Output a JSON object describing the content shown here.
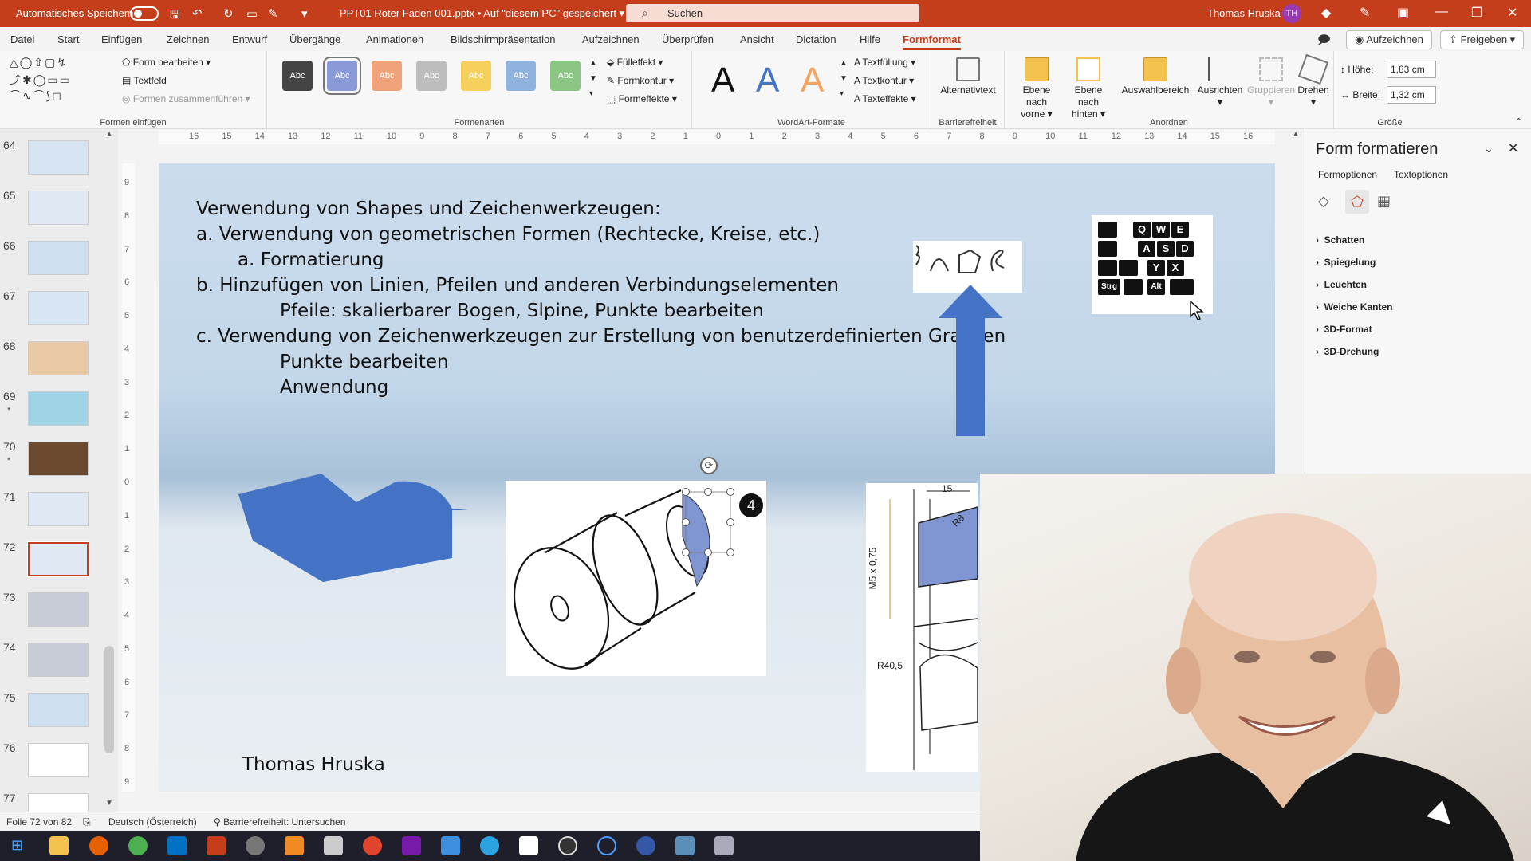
{
  "titlebar": {
    "autosave_label": "Automatisches Speichern",
    "filename": "PPT01 Roter Faden 001.pptx",
    "save_location": "Auf \"diesem PC\" gespeichert",
    "search_placeholder": "Suchen",
    "user_name": "Thomas Hruska",
    "user_initials": "TH"
  },
  "menu": {
    "tabs": [
      "Datei",
      "Start",
      "Einfügen",
      "Zeichnen",
      "Entwurf",
      "Übergänge",
      "Animationen",
      "Bildschirmpräsentation",
      "Aufzeichnen",
      "Überprüfen",
      "Ansicht",
      "Dictation",
      "Hilfe",
      "Formformat"
    ],
    "active_tab": "Formformat",
    "record_button": "Aufzeichnen",
    "share_button": "Freigeben"
  },
  "ribbon": {
    "insert_shapes": {
      "edit_shape": "Form bearbeiten",
      "textbox": "Textfeld",
      "merge_shapes": "Formen zusammenführen",
      "label": "Formen einfügen"
    },
    "shape_styles": {
      "style_text": "Abc",
      "fill": "Fülleffekt",
      "outline": "Formkontur",
      "effects": "Formeffekte",
      "label": "Formenarten"
    },
    "wordart": {
      "letter": "A",
      "text_fill": "Textfüllung",
      "text_outline": "Textkontur",
      "text_effects": "Texteffekte",
      "label": "WordArt-Formate"
    },
    "accessibility": {
      "alt_text": "Alternativtext",
      "label": "Barrierefreiheit"
    },
    "arrange": {
      "bring_forward_1": "Ebene nach",
      "bring_forward_2": "vorne",
      "send_backward_1": "Ebene nach",
      "send_backward_2": "hinten",
      "selection_pane": "Auswahlbereich",
      "align": "Ausrichten",
      "group": "Gruppieren",
      "rotate": "Drehen",
      "label": "Anordnen"
    },
    "size": {
      "height_label": "Höhe:",
      "height_value": "1,83 cm",
      "width_label": "Breite:",
      "width_value": "1,32 cm",
      "label": "Größe"
    }
  },
  "colors": {
    "accent": "#c43e1c",
    "shape_blue": "#4472c4",
    "taskbar": "#1f1f2b"
  },
  "ruler": {
    "h_ticks": [
      "16",
      "15",
      "14",
      "13",
      "12",
      "11",
      "10",
      "9",
      "8",
      "7",
      "6",
      "5",
      "4",
      "3",
      "2",
      "1",
      "0",
      "1",
      "2",
      "3",
      "4",
      "5",
      "6",
      "7",
      "8",
      "9",
      "10",
      "11",
      "12",
      "13",
      "14",
      "15",
      "16"
    ],
    "v_ticks": [
      "9",
      "8",
      "7",
      "6",
      "5",
      "4",
      "3",
      "2",
      "1",
      "0",
      "1",
      "2",
      "3",
      "4",
      "5",
      "6",
      "7",
      "8",
      "9"
    ]
  },
  "thumbnails": [
    {
      "num": "64",
      "star": ""
    },
    {
      "num": "65",
      "star": ""
    },
    {
      "num": "66",
      "star": ""
    },
    {
      "num": "67",
      "star": ""
    },
    {
      "num": "68",
      "star": ""
    },
    {
      "num": "69",
      "star": "*"
    },
    {
      "num": "70",
      "star": "*"
    },
    {
      "num": "71",
      "star": ""
    },
    {
      "num": "72",
      "star": ""
    },
    {
      "num": "73",
      "star": ""
    },
    {
      "num": "74",
      "star": ""
    },
    {
      "num": "75",
      "star": ""
    },
    {
      "num": "76",
      "star": ""
    },
    {
      "num": "77",
      "star": ""
    }
  ],
  "slide": {
    "lines": [
      "Verwendung von Shapes und Zeichenwerkzeugen:",
      "a.   Verwendung von geometrischen Formen (Rechtecke, Kreise, etc.)",
      "a.   Formatierung",
      "b. Hinzufügen von Linien, Pfeilen und anderen Verbindungselementen",
      "Pfeile: skalierbarer Bogen, Slpine, Punkte bearbeiten",
      "c. Verwendung von Zeichenwerkzeugen zur Erstellung von benutzerdefinierten Grafiken",
      "Punkte bearbeiten",
      "Anwendung"
    ],
    "author": "Thomas Hruska",
    "badge": "4",
    "keys": [
      "Q",
      "W",
      "E",
      "A",
      "S",
      "D",
      "Y",
      "X",
      "Strg",
      "Alt"
    ],
    "dims": {
      "d15": "15",
      "m5": "M5 x 0,75",
      "r40": "R40,5",
      "r8": "R8"
    }
  },
  "format_pane": {
    "title": "Form formatieren",
    "tabs": [
      "Formoptionen",
      "Textoptionen"
    ],
    "sections": [
      "Schatten",
      "Spiegelung",
      "Leuchten",
      "Weiche Kanten",
      "3D-Format",
      "3D-Drehung"
    ]
  },
  "status": {
    "slide_info": "Folie 72 von 82",
    "language": "Deutsch (Österreich)",
    "accessibility": "Barrierefreiheit: Untersuchen"
  }
}
